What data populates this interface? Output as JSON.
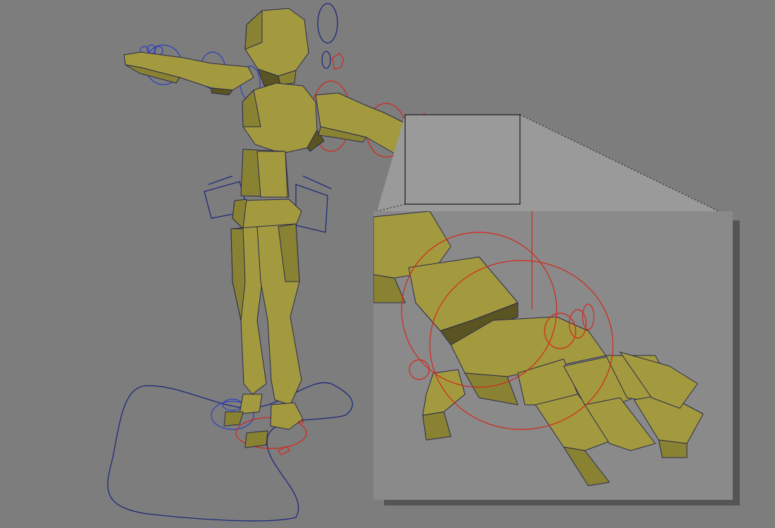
{
  "viewport": {
    "name": "3D rig viewport",
    "colors": {
      "background": "#7d7d7d",
      "mesh_lit": "#a39a3f",
      "mesh_mid": "#8a8233",
      "mesh_dark": "#5a5422",
      "wire": "#2a2a4a",
      "control_blue": "#2b3fbf",
      "control_red": "#d4271a",
      "control_navy": "#1e2a7a",
      "inset_panel": "#8a8a8a"
    },
    "objects": [
      "character-mesh",
      "ik-controls",
      "foot-control-curve",
      "zoom-inset-hand"
    ]
  }
}
